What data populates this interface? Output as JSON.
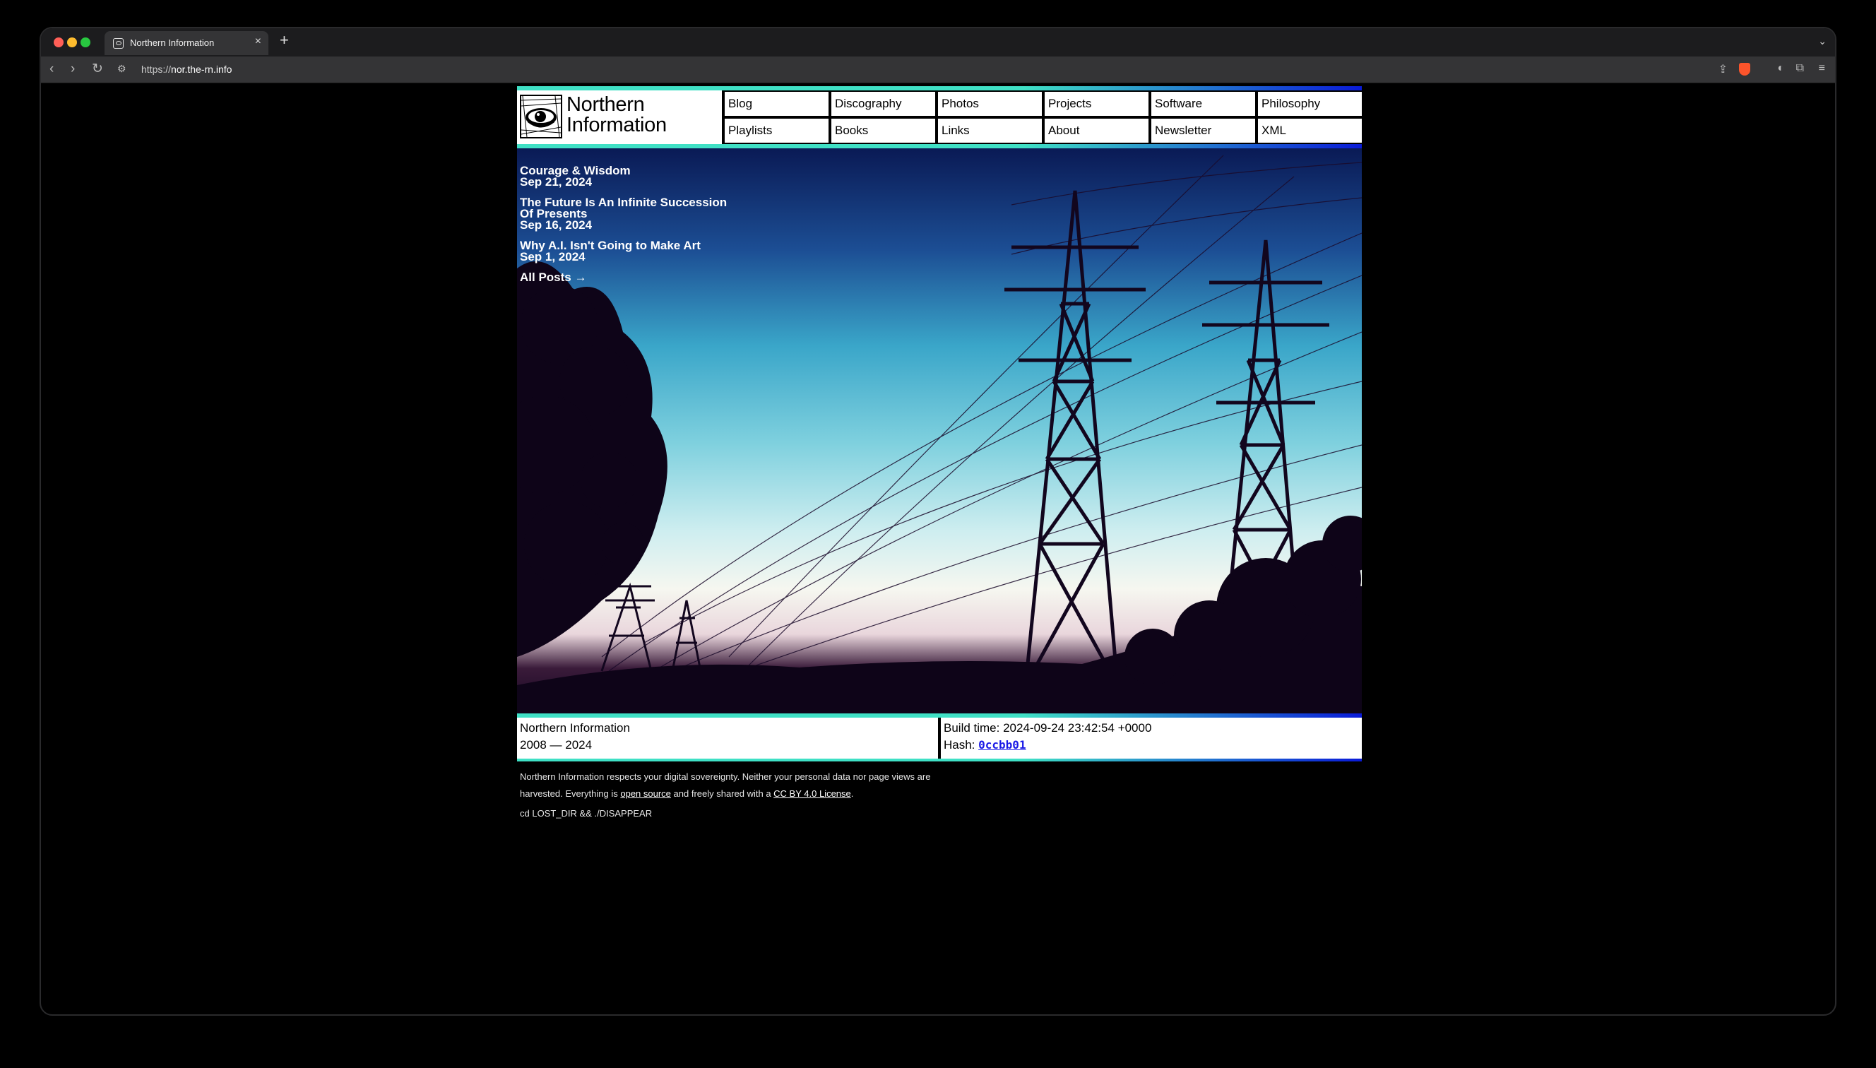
{
  "browser": {
    "tab_title": "Northern Information",
    "tab_close": "×",
    "new_tab": "+",
    "url_scheme": "https://",
    "url_host": "nor.the-rn.info"
  },
  "site": {
    "title_line1": "Northern",
    "title_line2": "Information",
    "nav": [
      "Blog",
      "Discography",
      "Photos",
      "Projects",
      "Software",
      "Philosophy",
      "Playlists",
      "Books",
      "Links",
      "About",
      "Newsletter",
      "XML"
    ]
  },
  "posts": [
    {
      "title": "Courage & Wisdom",
      "date": "Sep 21, 2024"
    },
    {
      "title": "The Future Is An Infinite Succession Of Presents",
      "date": "Sep 16, 2024"
    },
    {
      "title": "Why A.I. Isn't Going to Make Art",
      "date": "Sep 1, 2024"
    }
  ],
  "all_posts": "All Posts →",
  "footer": {
    "name": "Northern Information",
    "years": "2008 — 2024",
    "build_time": "Build time: 2024-09-24 23:42:54 +0000",
    "hash_label": "Hash: ",
    "hash": "0ccbb01"
  },
  "notice": {
    "part1": "Northern Information respects your digital sovereignty. Neither your personal data nor page views are harvested. Everything is ",
    "link1": "open source",
    "part2": " and freely shared with a ",
    "link2": "CC BY 4.0 License",
    "part3": "."
  },
  "command": "cd LOST_DIR && ./DISAPPEAR",
  "colors": {
    "accent_teal": "#3fe0c5",
    "accent_blue": "#0a1bd8",
    "hash_link": "#1a1ae6"
  }
}
